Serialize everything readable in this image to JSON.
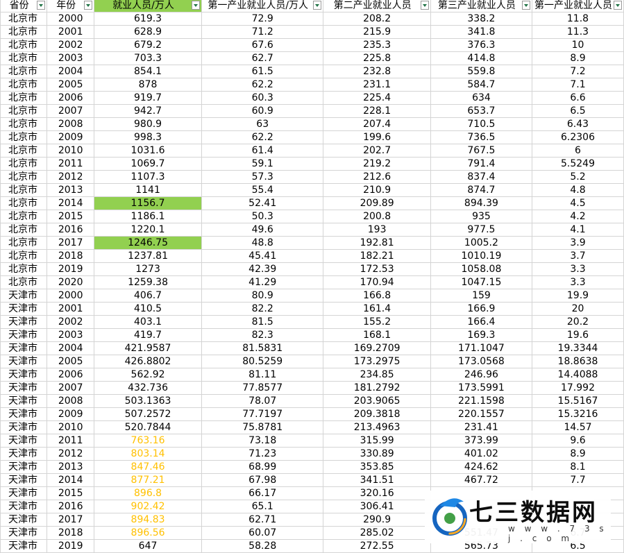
{
  "columns": [
    "省份",
    "年份",
    "就业人员/万人",
    "第一产业就业人员/万人",
    "第二产业就业人员",
    "第三产业就业人员",
    "第一产业就业人员"
  ],
  "column_widths": [
    68,
    69,
    158,
    176,
    156,
    147,
    125
  ],
  "colors": {
    "highlight_fill": "#92d050",
    "highlight_text": "#ffc000",
    "filter_arrow": "#217346",
    "grid": "#d4d4d4"
  },
  "rows": [
    {
      "cells": [
        "北京市",
        "2000",
        "619.3",
        "72.9",
        "208.2",
        "338.2",
        "11.8"
      ]
    },
    {
      "cells": [
        "北京市",
        "2001",
        "628.9",
        "71.2",
        "215.9",
        "341.8",
        "11.3"
      ]
    },
    {
      "cells": [
        "北京市",
        "2002",
        "679.2",
        "67.6",
        "235.3",
        "376.3",
        "10"
      ]
    },
    {
      "cells": [
        "北京市",
        "2003",
        "703.3",
        "62.7",
        "225.8",
        "414.8",
        "8.9"
      ]
    },
    {
      "cells": [
        "北京市",
        "2004",
        "854.1",
        "61.5",
        "232.8",
        "559.8",
        "7.2"
      ]
    },
    {
      "cells": [
        "北京市",
        "2005",
        "878",
        "62.2",
        "231.1",
        "584.7",
        "7.1"
      ]
    },
    {
      "cells": [
        "北京市",
        "2006",
        "919.7",
        "60.3",
        "225.4",
        "634",
        "6.6"
      ]
    },
    {
      "cells": [
        "北京市",
        "2007",
        "942.7",
        "60.9",
        "228.1",
        "653.7",
        "6.5"
      ]
    },
    {
      "cells": [
        "北京市",
        "2008",
        "980.9",
        "63",
        "207.4",
        "710.5",
        "6.43"
      ]
    },
    {
      "cells": [
        "北京市",
        "2009",
        "998.3",
        "62.2",
        "199.6",
        "736.5",
        "6.2306"
      ]
    },
    {
      "cells": [
        "北京市",
        "2010",
        "1031.6",
        "61.4",
        "202.7",
        "767.5",
        "6"
      ]
    },
    {
      "cells": [
        "北京市",
        "2011",
        "1069.7",
        "59.1",
        "219.2",
        "791.4",
        "5.5249"
      ]
    },
    {
      "cells": [
        "北京市",
        "2012",
        "1107.3",
        "57.3",
        "212.6",
        "837.4",
        "5.2"
      ]
    },
    {
      "cells": [
        "北京市",
        "2013",
        "1141",
        "55.4",
        "210.9",
        "874.7",
        "4.8"
      ]
    },
    {
      "cells": [
        "北京市",
        "2014",
        "1156.7",
        "52.41",
        "209.89",
        "894.39",
        "4.5"
      ],
      "fill": true
    },
    {
      "cells": [
        "北京市",
        "2015",
        "1186.1",
        "50.3",
        "200.8",
        "935",
        "4.2"
      ]
    },
    {
      "cells": [
        "北京市",
        "2016",
        "1220.1",
        "49.6",
        "193",
        "977.5",
        "4.1"
      ]
    },
    {
      "cells": [
        "北京市",
        "2017",
        "1246.75",
        "48.8",
        "192.81",
        "1005.2",
        "3.9"
      ],
      "fill": true
    },
    {
      "cells": [
        "北京市",
        "2018",
        "1237.81",
        "45.41",
        "182.21",
        "1010.19",
        "3.7"
      ]
    },
    {
      "cells": [
        "北京市",
        "2019",
        "1273",
        "42.39",
        "172.53",
        "1058.08",
        "3.3"
      ]
    },
    {
      "cells": [
        "北京市",
        "2020",
        "1259.38",
        "41.29",
        "170.94",
        "1047.15",
        "3.3"
      ]
    },
    {
      "cells": [
        "天津市",
        "2000",
        "406.7",
        "80.9",
        "166.8",
        "159",
        "19.9"
      ]
    },
    {
      "cells": [
        "天津市",
        "2001",
        "410.5",
        "82.2",
        "161.4",
        "166.9",
        "20"
      ]
    },
    {
      "cells": [
        "天津市",
        "2002",
        "403.1",
        "81.5",
        "155.2",
        "166.4",
        "20.2"
      ]
    },
    {
      "cells": [
        "天津市",
        "2003",
        "419.7",
        "82.3",
        "168.1",
        "169.3",
        "19.6"
      ]
    },
    {
      "cells": [
        "天津市",
        "2004",
        "421.9587",
        "81.5831",
        "169.2709",
        "171.1047",
        "19.3344"
      ]
    },
    {
      "cells": [
        "天津市",
        "2005",
        "426.8802",
        "80.5259",
        "173.2975",
        "173.0568",
        "18.8638"
      ]
    },
    {
      "cells": [
        "天津市",
        "2006",
        "562.92",
        "81.11",
        "234.85",
        "246.96",
        "14.4088"
      ]
    },
    {
      "cells": [
        "天津市",
        "2007",
        "432.736",
        "77.8577",
        "181.2792",
        "173.5991",
        "17.992"
      ]
    },
    {
      "cells": [
        "天津市",
        "2008",
        "503.1363",
        "78.07",
        "203.9065",
        "221.1598",
        "15.5167"
      ]
    },
    {
      "cells": [
        "天津市",
        "2009",
        "507.2572",
        "77.7197",
        "209.3818",
        "220.1557",
        "15.3216"
      ]
    },
    {
      "cells": [
        "天津市",
        "2010",
        "520.7844",
        "75.8781",
        "213.4963",
        "231.41",
        "14.57"
      ]
    },
    {
      "cells": [
        "天津市",
        "2011",
        "763.16",
        "73.18",
        "315.99",
        "373.99",
        "9.6"
      ],
      "gold": true
    },
    {
      "cells": [
        "天津市",
        "2012",
        "803.14",
        "71.23",
        "330.89",
        "401.02",
        "8.9"
      ],
      "gold": true
    },
    {
      "cells": [
        "天津市",
        "2013",
        "847.46",
        "68.99",
        "353.85",
        "424.62",
        "8.1"
      ],
      "gold": true
    },
    {
      "cells": [
        "天津市",
        "2014",
        "877.21",
        "67.98",
        "341.51",
        "467.72",
        "7.7"
      ],
      "gold": true
    },
    {
      "cells": [
        "天津市",
        "2015",
        "896.8",
        "66.17",
        "320.16",
        "",
        ""
      ],
      "gold": true
    },
    {
      "cells": [
        "天津市",
        "2016",
        "902.42",
        "65.1",
        "306.41",
        "",
        ""
      ],
      "gold": true
    },
    {
      "cells": [
        "天津市",
        "2017",
        "894.83",
        "62.71",
        "290.9",
        "",
        ""
      ],
      "gold": true
    },
    {
      "cells": [
        "天津市",
        "2018",
        "896.56",
        "60.07",
        "285.02",
        "551.47",
        "6.7"
      ],
      "gold": true
    },
    {
      "cells": [
        "天津市",
        "2019",
        "647",
        "58.28",
        "272.55",
        "565.73",
        "6.5"
      ]
    }
  ],
  "watermark": {
    "title": "七三数据网",
    "url": "w w w . 7 3 s j . c o m"
  }
}
